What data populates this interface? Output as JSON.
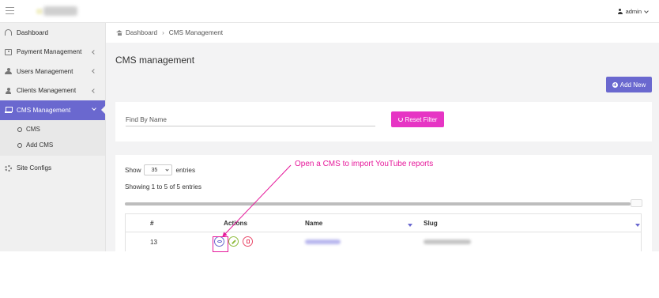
{
  "topbar": {
    "menu_icon": "hamburger-icon",
    "user_icon": "user-icon",
    "user_name": "admin"
  },
  "sidebar": {
    "items": [
      {
        "label": "Dashboard",
        "icon": "dashboard-icon"
      },
      {
        "label": "Payment Management",
        "icon": "money-icon"
      },
      {
        "label": "Users Management",
        "icon": "users-icon"
      },
      {
        "label": "Clients Management",
        "icon": "user-icon"
      },
      {
        "label": "CMS Management",
        "icon": "laptop-icon",
        "active": true
      },
      {
        "label": "Site Configs",
        "icon": "gear-icon"
      }
    ],
    "submenu": [
      {
        "label": "CMS"
      },
      {
        "label": "Add CMS"
      }
    ]
  },
  "breadcrumb": {
    "home_icon": "home-icon",
    "items": [
      "Dashboard",
      "CMS Management"
    ]
  },
  "page": {
    "title": "CMS management",
    "add_button": "Add New"
  },
  "filter": {
    "find_placeholder": "Find By Name",
    "reset_button": "Reset Filter"
  },
  "table": {
    "show_label": "Show",
    "entries_value": "35",
    "entries_label": "entries",
    "info": "Showing 1 to 5 of 5 entries",
    "columns": [
      "#",
      "Actions",
      "Name",
      "Slug"
    ],
    "rows": [
      {
        "id": "13"
      }
    ]
  },
  "annotation": {
    "text": "Open a CMS to import YouTube reports"
  },
  "colors": {
    "accent": "#6a68cf",
    "reset": "#e635c4",
    "annotation": "#e6199b"
  }
}
